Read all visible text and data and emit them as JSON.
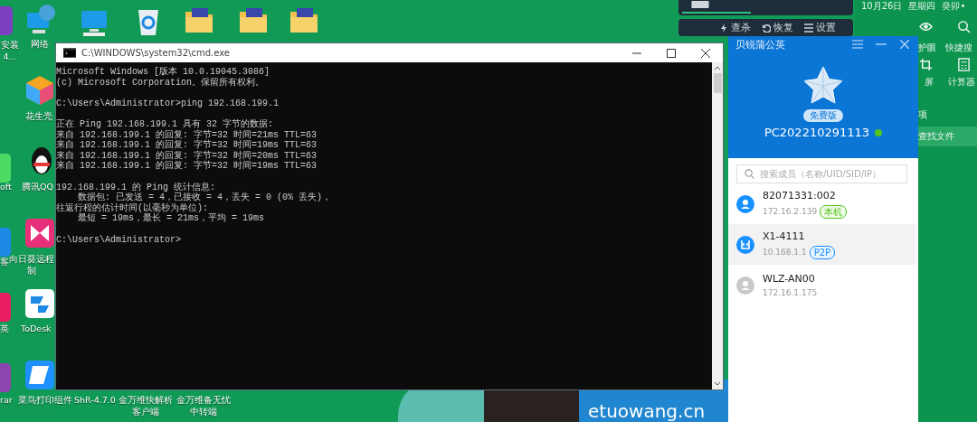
{
  "desktop": {
    "icons": [
      {
        "kind": "installer",
        "label": "安装4..."
      },
      {
        "kind": "app-green",
        "label": "oft"
      },
      {
        "kind": "app-blue",
        "label": "客"
      },
      {
        "kind": "app-pink",
        "label": "英"
      },
      {
        "kind": "archive",
        "label": "rar"
      },
      {
        "kind": "network",
        "label": "网络"
      },
      {
        "kind": "cube",
        "label": "花生壳"
      },
      {
        "kind": "penguin",
        "label": "腾讯QQ"
      },
      {
        "kind": "remote",
        "label": "向日葵远程制"
      },
      {
        "kind": "todesk",
        "label": "ToDesk"
      },
      {
        "kind": "print",
        "label": "菜鸟打印组件"
      },
      {
        "kind": "none",
        "label": "ShR-4.7.0"
      },
      {
        "kind": "none",
        "label": "金万维快解析客户端"
      },
      {
        "kind": "none",
        "label": "金万维备无忧中转端"
      },
      {
        "kind": "monitor"
      },
      {
        "kind": "recycle-bin"
      },
      {
        "kind": "folder"
      },
      {
        "kind": "folder"
      },
      {
        "kind": "folder"
      }
    ]
  },
  "security_panel": {
    "progress": {
      "level": 0.42
    },
    "buttons": [
      {
        "kind": "scan",
        "label": "查杀"
      },
      {
        "kind": "restore",
        "label": "恢复"
      },
      {
        "kind": "settings",
        "label": "设置"
      }
    ]
  },
  "side_panel": {
    "date": "10月26日",
    "weekday": "星期四",
    "lunar": "癸卯•",
    "tools": [
      {
        "kind": "eye",
        "label": "护眼"
      },
      {
        "kind": "search",
        "label": "快捷搜"
      },
      {
        "kind": "crop",
        "label": "屏"
      },
      {
        "kind": "calculator",
        "label": "计算器"
      }
    ],
    "section": "项",
    "find_files": "查找文件"
  },
  "cmd": {
    "title": "C:\\WINDOWS\\system32\\cmd.exe",
    "blocks": [
      [
        "Microsoft Windows [版本 10.0.19045.3086]",
        "(c) Microsoft Corporation。保留所有权利。"
      ],
      [
        "C:\\Users\\Administrator>ping 192.168.199.1"
      ],
      [
        "正在 Ping 192.168.199.1 具有 32 字节的数据:",
        "来自 192.168.199.1 的回复: 字节=32 时间=21ms TTL=63",
        "来自 192.168.199.1 的回复: 字节=32 时间=19ms TTL=63",
        "来自 192.168.199.1 的回复: 字节=32 时间=20ms TTL=63",
        "来自 192.168.199.1 的回复: 字节=32 时间=19ms TTL=63"
      ],
      [
        "192.168.199.1 的 Ping 统计信息:",
        "    数据包: 已发送 = 4，已接收 = 4，丢失 = 0 (0% 丢失)，",
        "往返行程的估计时间(以毫秒为单位):",
        "    最短 = 19ms，最长 = 21ms，平均 = 19ms"
      ],
      [
        "C:\\Users\\Administrator>"
      ]
    ]
  },
  "wallpaper": {
    "text": "etuowang.cn"
  },
  "vpn_app": {
    "title": "贝锐蒲公英",
    "edition": "免费版",
    "device": "PC202210291113",
    "online": true,
    "search": {
      "placeholder": "搜索成员（名称/UID/SID/IP）"
    },
    "members": [
      {
        "name": "82071331:002",
        "ip": "172.16.2.139",
        "tag": {
          "kind": "local",
          "label": "本机"
        },
        "kind": "user",
        "online": true,
        "selected": false
      },
      {
        "name": "X1-4111",
        "ip": "10.168.1.1",
        "tag": {
          "kind": "p2p",
          "label": "P2P"
        },
        "kind": "router",
        "online": true,
        "selected": true
      },
      {
        "name": "WLZ-AN00",
        "ip": "172.16.1.175",
        "kind": "user",
        "online": false,
        "selected": false
      }
    ]
  }
}
